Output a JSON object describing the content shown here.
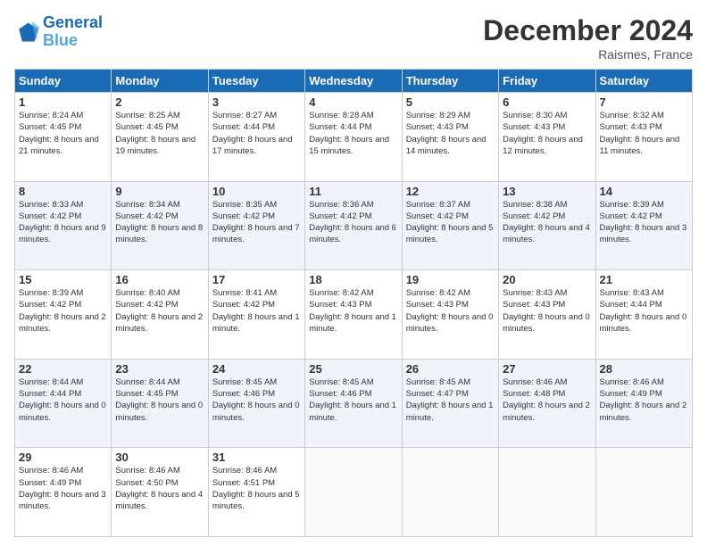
{
  "header": {
    "logo_line1": "General",
    "logo_line2": "Blue",
    "month_title": "December 2024",
    "location": "Raismes, France"
  },
  "weekdays": [
    "Sunday",
    "Monday",
    "Tuesday",
    "Wednesday",
    "Thursday",
    "Friday",
    "Saturday"
  ],
  "weeks": [
    [
      {
        "day": 1,
        "sunrise": "8:24 AM",
        "sunset": "4:45 PM",
        "daylight": "8 hours and 21 minutes."
      },
      {
        "day": 2,
        "sunrise": "8:25 AM",
        "sunset": "4:45 PM",
        "daylight": "8 hours and 19 minutes."
      },
      {
        "day": 3,
        "sunrise": "8:27 AM",
        "sunset": "4:44 PM",
        "daylight": "8 hours and 17 minutes."
      },
      {
        "day": 4,
        "sunrise": "8:28 AM",
        "sunset": "4:44 PM",
        "daylight": "8 hours and 15 minutes."
      },
      {
        "day": 5,
        "sunrise": "8:29 AM",
        "sunset": "4:43 PM",
        "daylight": "8 hours and 14 minutes."
      },
      {
        "day": 6,
        "sunrise": "8:30 AM",
        "sunset": "4:43 PM",
        "daylight": "8 hours and 12 minutes."
      },
      {
        "day": 7,
        "sunrise": "8:32 AM",
        "sunset": "4:43 PM",
        "daylight": "8 hours and 11 minutes."
      }
    ],
    [
      {
        "day": 8,
        "sunrise": "8:33 AM",
        "sunset": "4:42 PM",
        "daylight": "8 hours and 9 minutes."
      },
      {
        "day": 9,
        "sunrise": "8:34 AM",
        "sunset": "4:42 PM",
        "daylight": "8 hours and 8 minutes."
      },
      {
        "day": 10,
        "sunrise": "8:35 AM",
        "sunset": "4:42 PM",
        "daylight": "8 hours and 7 minutes."
      },
      {
        "day": 11,
        "sunrise": "8:36 AM",
        "sunset": "4:42 PM",
        "daylight": "8 hours and 6 minutes."
      },
      {
        "day": 12,
        "sunrise": "8:37 AM",
        "sunset": "4:42 PM",
        "daylight": "8 hours and 5 minutes."
      },
      {
        "day": 13,
        "sunrise": "8:38 AM",
        "sunset": "4:42 PM",
        "daylight": "8 hours and 4 minutes."
      },
      {
        "day": 14,
        "sunrise": "8:39 AM",
        "sunset": "4:42 PM",
        "daylight": "8 hours and 3 minutes."
      }
    ],
    [
      {
        "day": 15,
        "sunrise": "8:39 AM",
        "sunset": "4:42 PM",
        "daylight": "8 hours and 2 minutes."
      },
      {
        "day": 16,
        "sunrise": "8:40 AM",
        "sunset": "4:42 PM",
        "daylight": "8 hours and 2 minutes."
      },
      {
        "day": 17,
        "sunrise": "8:41 AM",
        "sunset": "4:42 PM",
        "daylight": "8 hours and 1 minute."
      },
      {
        "day": 18,
        "sunrise": "8:42 AM",
        "sunset": "4:43 PM",
        "daylight": "8 hours and 1 minute."
      },
      {
        "day": 19,
        "sunrise": "8:42 AM",
        "sunset": "4:43 PM",
        "daylight": "8 hours and 0 minutes."
      },
      {
        "day": 20,
        "sunrise": "8:43 AM",
        "sunset": "4:43 PM",
        "daylight": "8 hours and 0 minutes."
      },
      {
        "day": 21,
        "sunrise": "8:43 AM",
        "sunset": "4:44 PM",
        "daylight": "8 hours and 0 minutes."
      }
    ],
    [
      {
        "day": 22,
        "sunrise": "8:44 AM",
        "sunset": "4:44 PM",
        "daylight": "8 hours and 0 minutes."
      },
      {
        "day": 23,
        "sunrise": "8:44 AM",
        "sunset": "4:45 PM",
        "daylight": "8 hours and 0 minutes."
      },
      {
        "day": 24,
        "sunrise": "8:45 AM",
        "sunset": "4:46 PM",
        "daylight": "8 hours and 0 minutes."
      },
      {
        "day": 25,
        "sunrise": "8:45 AM",
        "sunset": "4:46 PM",
        "daylight": "8 hours and 1 minute."
      },
      {
        "day": 26,
        "sunrise": "8:45 AM",
        "sunset": "4:47 PM",
        "daylight": "8 hours and 1 minute."
      },
      {
        "day": 27,
        "sunrise": "8:46 AM",
        "sunset": "4:48 PM",
        "daylight": "8 hours and 2 minutes."
      },
      {
        "day": 28,
        "sunrise": "8:46 AM",
        "sunset": "4:49 PM",
        "daylight": "8 hours and 2 minutes."
      }
    ],
    [
      {
        "day": 29,
        "sunrise": "8:46 AM",
        "sunset": "4:49 PM",
        "daylight": "8 hours and 3 minutes."
      },
      {
        "day": 30,
        "sunrise": "8:46 AM",
        "sunset": "4:50 PM",
        "daylight": "8 hours and 4 minutes."
      },
      {
        "day": 31,
        "sunrise": "8:46 AM",
        "sunset": "4:51 PM",
        "daylight": "8 hours and 5 minutes."
      },
      null,
      null,
      null,
      null
    ]
  ]
}
